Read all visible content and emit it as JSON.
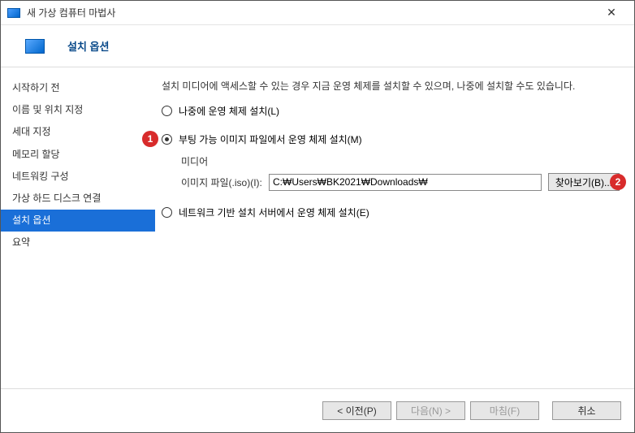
{
  "titlebar": {
    "title": "새 가상 컴퓨터 마법사"
  },
  "header": {
    "title": "설치 옵션"
  },
  "sidebar": {
    "items": [
      {
        "label": "시작하기 전"
      },
      {
        "label": "이름 및 위치 지정"
      },
      {
        "label": "세대 지정"
      },
      {
        "label": "메모리 할당"
      },
      {
        "label": "네트워킹 구성"
      },
      {
        "label": "가상 하드 디스크 연결"
      },
      {
        "label": "설치 옵션"
      },
      {
        "label": "요약"
      }
    ],
    "selected_index": 6
  },
  "content": {
    "description": "설치 미디어에 액세스할 수 있는 경우 지금 운영 체제를 설치할 수 있으며, 나중에 설치할 수도 있습니다.",
    "options": {
      "later": {
        "label": "나중에 운영 체제 설치(L)",
        "checked": false
      },
      "bootable": {
        "label": "부팅 가능 이미지 파일에서 운영 체제 설치(M)",
        "checked": true
      },
      "network": {
        "label": "네트워크 기반 설치 서버에서 운영 체제 설치(E)",
        "checked": false
      }
    },
    "media": {
      "group_label": "미디어",
      "field_label": "이미지 파일(.iso)(I):",
      "value": "C:₩Users₩BK2021₩Downloads₩",
      "browse_label": "찾아보기(B)..."
    }
  },
  "annotations": {
    "1": "1",
    "2": "2"
  },
  "footer": {
    "prev": "< 이전(P)",
    "next": "다음(N) >",
    "finish": "마침(F)",
    "cancel": "취소"
  }
}
